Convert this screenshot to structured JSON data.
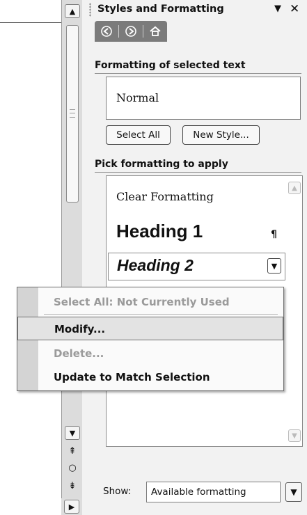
{
  "pane": {
    "title": "Styles and Formatting",
    "dropdown_icon": "▼",
    "close_icon": "✕",
    "nav": {
      "back_icon": "back-arrow-icon",
      "forward_icon": "forward-arrow-icon",
      "home_icon": "home-icon"
    }
  },
  "current": {
    "label": "Formatting of selected text",
    "style": "Normal",
    "select_all_label": "Select All",
    "new_style_label": "New Style..."
  },
  "apply": {
    "label": "Pick formatting to apply",
    "items": [
      {
        "name": "Clear Formatting"
      },
      {
        "name": "Heading 1",
        "mark": "¶"
      },
      {
        "name": "Heading 2"
      }
    ]
  },
  "show": {
    "label": "Show:",
    "value": "Available formatting"
  },
  "context_menu": {
    "items": [
      {
        "label": "Select All: Not Currently Used",
        "enabled": false
      },
      {
        "label": "Modify...",
        "enabled": true,
        "hover": true
      },
      {
        "label": "Delete...",
        "enabled": false
      },
      {
        "label": "Update to Match Selection",
        "enabled": true
      }
    ]
  },
  "colors": {
    "pane_bg": "#f2f2f2",
    "nav_bar": "#7b7b7b",
    "disabled_text": "#9a9a9a",
    "menu_hover": "#e3e3e3"
  }
}
